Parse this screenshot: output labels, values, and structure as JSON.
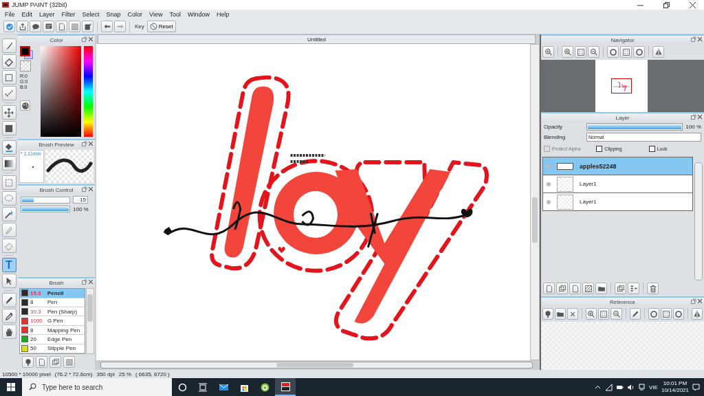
{
  "window": {
    "title": "JUMP PAINT (32bit)"
  },
  "menu": [
    "File",
    "Edit",
    "Layer",
    "Filter",
    "Select",
    "Snap",
    "Color",
    "View",
    "Tool",
    "Window",
    "Help"
  ],
  "toolbar": {
    "key_label": "Key",
    "reset_button": "Reset"
  },
  "tools": [
    {
      "kind": "brush",
      "selected": false
    },
    {
      "kind": "eraser",
      "selected": false
    },
    {
      "kind": "rectangle",
      "selected": false
    },
    {
      "kind": "dots",
      "selected": false
    },
    {
      "kind": "move",
      "selected": false
    },
    {
      "kind": "fill-rect",
      "selected": false
    },
    {
      "kind": "bucket",
      "selected": false
    },
    {
      "kind": "gradient",
      "selected": false
    },
    {
      "kind": "rect-select",
      "selected": false
    },
    {
      "kind": "lasso",
      "selected": false
    },
    {
      "kind": "wand",
      "selected": false
    },
    {
      "kind": "select-pen",
      "selected": false
    },
    {
      "kind": "select-eraser",
      "selected": false
    },
    {
      "kind": "text",
      "glyph": "T",
      "selected": true
    },
    {
      "kind": "pointer",
      "selected": false
    },
    {
      "kind": "pen",
      "selected": false
    },
    {
      "kind": "eyedropper",
      "selected": false
    },
    {
      "kind": "hand",
      "selected": false
    }
  ],
  "color_panel": {
    "title": "Color",
    "readouts": [
      "R:0",
      "G:0",
      "B:0"
    ]
  },
  "brush_preview": {
    "title": "Brush Preview",
    "size": "* 1.11mm"
  },
  "brush_control": {
    "title": "Brush Control",
    "sliders": [
      {
        "level": 0.25,
        "reading": "15"
      },
      {
        "level": 1,
        "reading": "100 %"
      }
    ]
  },
  "brush_panel": {
    "title": "Brush",
    "brushes": [
      {
        "size": "15.3",
        "name": "Pencil",
        "color": "#2a2a2a",
        "modified": true,
        "selected": true
      },
      {
        "size": "8",
        "name": "Pen",
        "color": "#2a2a2a",
        "modified": false,
        "selected": false
      },
      {
        "size": "30.3",
        "name": "Pen (Sharp)",
        "color": "#2a2a2a",
        "modified": true,
        "selected": false
      },
      {
        "size": "1000",
        "name": "G Pen",
        "color": "#e53030",
        "modified": true,
        "selected": false
      },
      {
        "size": "8",
        "name": "Mapping Pen",
        "color": "#e53030",
        "modified": false,
        "selected": false
      },
      {
        "size": "20",
        "name": "Edge Pen",
        "color": "#22aa22",
        "modified": false,
        "selected": false
      },
      {
        "size": "50",
        "name": "Stipple Pen",
        "color": "#dddd22",
        "modified": false,
        "selected": false
      }
    ]
  },
  "document": {
    "tab": "Untitled"
  },
  "navigator": {
    "title": "Navigator"
  },
  "layer_panel": {
    "title": "Layer",
    "opacity": {
      "label": "Opacity",
      "level": 1,
      "reading": "100 %"
    },
    "blending": {
      "label": "Blending",
      "value": "Normal"
    },
    "options": [
      {
        "label": "Protect Alpha",
        "checked": false,
        "disabled": true
      },
      {
        "label": "Clipping",
        "checked": false,
        "disabled": false
      },
      {
        "label": "Lock",
        "checked": false,
        "disabled": false
      }
    ],
    "layers": [
      {
        "name": "apples52248",
        "kind": "text",
        "selected": true
      },
      {
        "name": "Layer1",
        "kind": "raster",
        "selected": false
      },
      {
        "name": "Layer1",
        "kind": "raster",
        "selected": false
      }
    ]
  },
  "reference": {
    "title": "Reference"
  },
  "status_bar": [
    "10500 * 10000 pixel",
    "(76.2 * 72.6cm)",
    "350 dpi",
    "25 %",
    "( 6635, 6720 )"
  ],
  "taskbar": {
    "search_placeholder": "Type here to search",
    "language": "VIE",
    "time": "10:01 PM",
    "date": "10/14/2021"
  }
}
